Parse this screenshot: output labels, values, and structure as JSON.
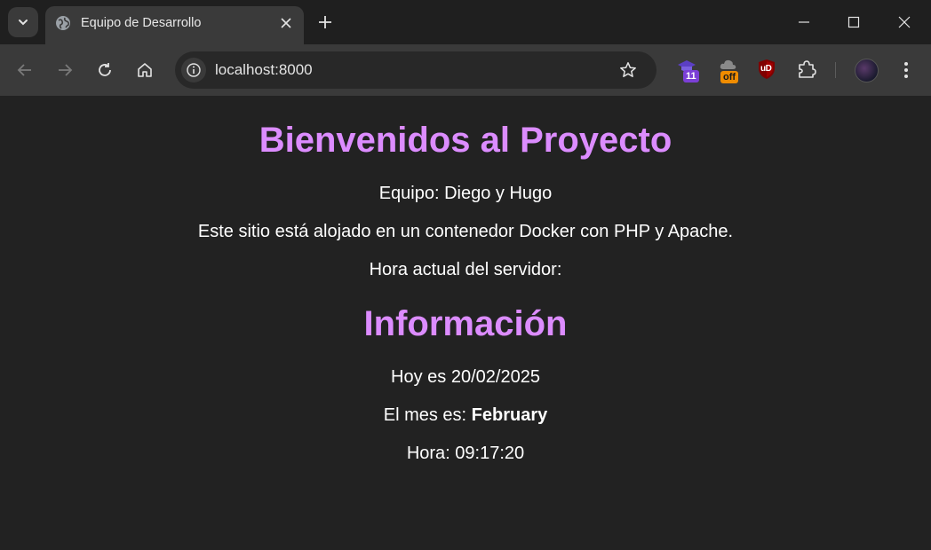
{
  "browser": {
    "tab_title": "Equipo de Desarrollo",
    "url": "localhost:8000",
    "extensions": [
      {
        "name": "extension-11",
        "badge": "11",
        "badge_color": "#7b3fd6"
      },
      {
        "name": "extension-off",
        "badge": "off",
        "badge_color": "#f08c00"
      },
      {
        "name": "ublock-origin",
        "badge": "uD"
      }
    ]
  },
  "page": {
    "heading": "Bienvenidos al Proyecto",
    "team": "Equipo: Diego y Hugo",
    "description": "Este sitio está alojado en un contenedor Docker con PHP y Apache.",
    "server_time_label": "Hora actual del servidor:",
    "info_heading": "Información",
    "today": "Hoy es 20/02/2025",
    "month_label": "El mes es: ",
    "month_value": "February",
    "time": "Hora: 09:17:20"
  },
  "colors": {
    "heading": "#dc8cff",
    "page_background": "#222222",
    "text": "#ffffff"
  }
}
